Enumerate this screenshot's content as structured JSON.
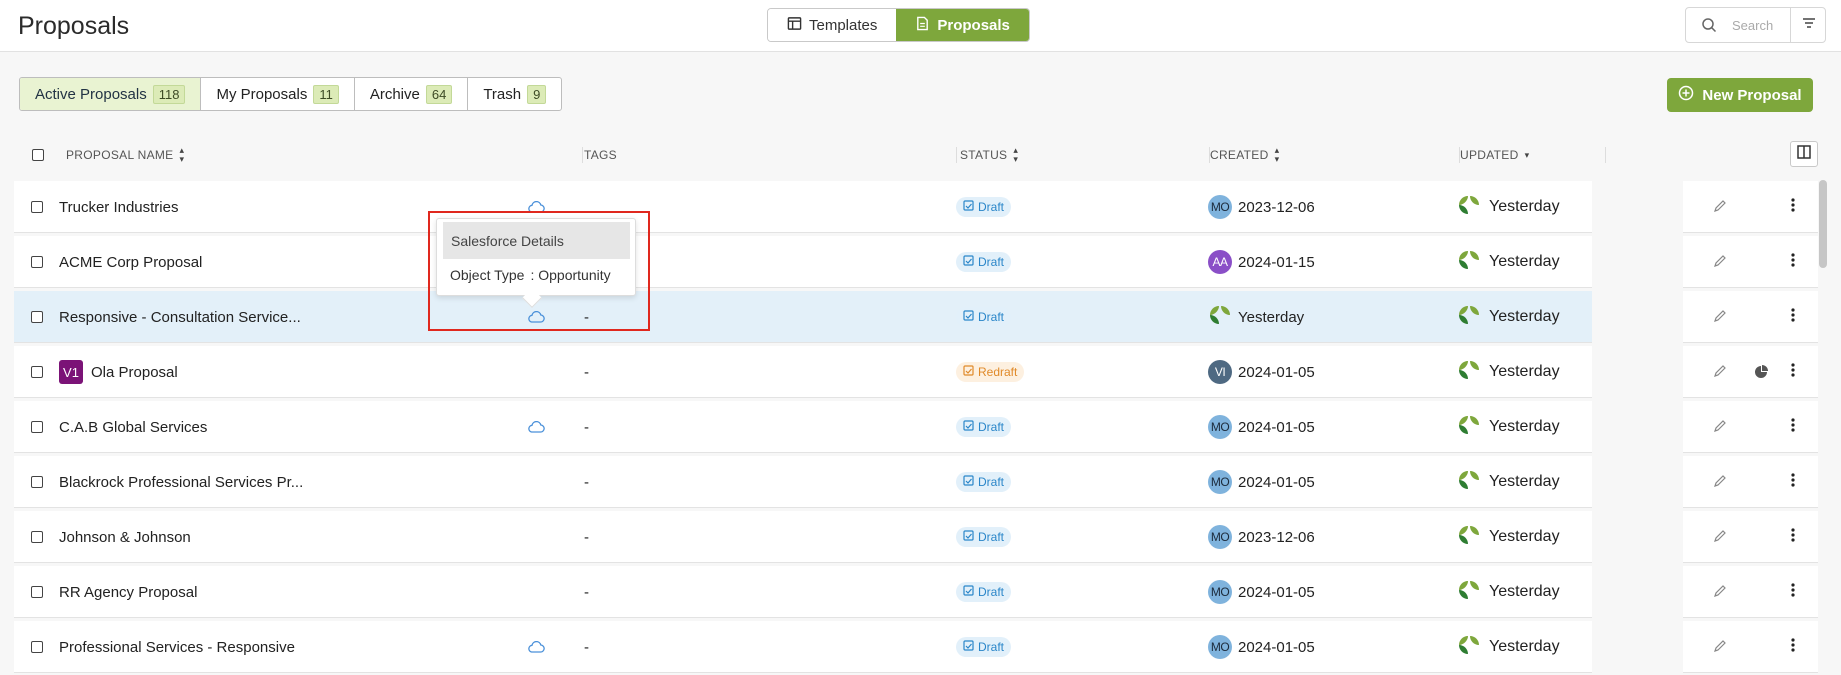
{
  "header": {
    "title": "Proposals",
    "segment": [
      {
        "label": "Templates",
        "icon": "template-icon",
        "active": false
      },
      {
        "label": "Proposals",
        "icon": "document-icon",
        "active": true
      }
    ],
    "search_placeholder": "Search"
  },
  "tabs": [
    {
      "label": "Active Proposals",
      "count": "118",
      "active": true
    },
    {
      "label": "My Proposals",
      "count": "11",
      "active": false
    },
    {
      "label": "Archive",
      "count": "64",
      "active": false
    },
    {
      "label": "Trash",
      "count": "9",
      "active": false
    }
  ],
  "new_button": "New Proposal",
  "columns": {
    "name": "PROPOSAL NAME",
    "tags": "TAGS",
    "status": "STATUS",
    "created": "CREATED",
    "updated": "UPDATED"
  },
  "rows": [
    {
      "name": "Trucker Industries",
      "cloud": true,
      "tags": "",
      "status": "Draft",
      "creator": "MO",
      "created": "2023-12-06",
      "updated": "Yesterday"
    },
    {
      "name": "ACME Corp Proposal",
      "cloud": false,
      "tags": "",
      "status": "Draft",
      "creator": "AA",
      "created": "2024-01-15",
      "updated": "Yesterday"
    },
    {
      "name": "Responsive - Consultation Service...",
      "cloud": true,
      "tags": "-",
      "status": "Draft",
      "creator": "",
      "created": "Yesterday",
      "updated": "Yesterday"
    },
    {
      "name": "Ola Proposal",
      "version": "V1",
      "cloud": false,
      "tags": "-",
      "status": "Redraft",
      "creator": "VI",
      "created": "2024-01-05",
      "updated": "Yesterday"
    },
    {
      "name": "C.A.B Global Services",
      "cloud": true,
      "tags": "-",
      "status": "Draft",
      "creator": "MO",
      "created": "2024-01-05",
      "updated": "Yesterday"
    },
    {
      "name": "Blackrock Professional Services Pr...",
      "cloud": false,
      "tags": "-",
      "status": "Draft",
      "creator": "MO",
      "created": "2024-01-05",
      "updated": "Yesterday"
    },
    {
      "name": "Johnson & Johnson",
      "cloud": false,
      "tags": "-",
      "status": "Draft",
      "creator": "MO",
      "created": "2023-12-06",
      "updated": "Yesterday"
    },
    {
      "name": "RR Agency Proposal",
      "cloud": false,
      "tags": "-",
      "status": "Draft",
      "creator": "MO",
      "created": "2024-01-05",
      "updated": "Yesterday"
    },
    {
      "name": "Professional Services - Responsive",
      "cloud": true,
      "tags": "-",
      "status": "Draft",
      "creator": "MO",
      "created": "2024-01-05",
      "updated": "Yesterday"
    }
  ],
  "tooltip": {
    "title": "Salesforce Details",
    "key": "Object Type",
    "value": ": Opportunity"
  },
  "colors": {
    "brand_green": "#7ea73c",
    "draft_blue": "#2a86c9",
    "redraft_orange": "#e08a2a",
    "highlight_red": "#e0281e"
  }
}
